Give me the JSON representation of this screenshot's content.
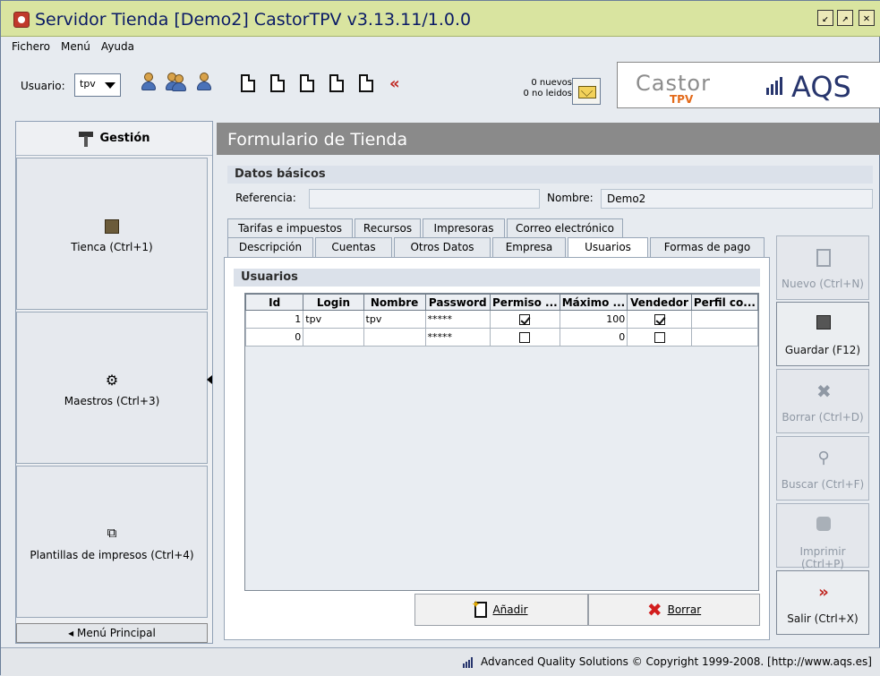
{
  "window": {
    "title": "Servidor Tienda  [Demo2] CastorTPV v3.13.11/1.0.0"
  },
  "menubar": [
    "Fichero",
    "Menú",
    "Ayuda"
  ],
  "toolbar": {
    "user_label": "Usuario:",
    "user_value": "tpv",
    "messages_new": "0 nuevos",
    "messages_unread": "0 no leidos",
    "logo_castor": "Castor",
    "logo_tpv": "TPV",
    "logo_aqs": "AQS"
  },
  "sidebar": {
    "header": "Gestión",
    "items": [
      {
        "label": "Tienca (Ctrl+1)",
        "icon": "store-icon"
      },
      {
        "label": "Maestros (Ctrl+3)",
        "icon": "gear-icon"
      },
      {
        "label": "Plantillas de impresos (Ctrl+4)",
        "icon": "copy-icon"
      }
    ],
    "footer": "Menú Principal"
  },
  "form": {
    "title": "Formulario de Tienda",
    "section_basic": "Datos básicos",
    "referencia_label": "Referencia:",
    "referencia_value": "",
    "nombre_label": "Nombre:",
    "nombre_value": "Demo2",
    "tabs_row1": [
      "Tarifas e impuestos",
      "Recursos",
      "Impresoras",
      "Correo electrónico"
    ],
    "tabs_row2": [
      "Descripción",
      "Cuentas",
      "Otros Datos",
      "Empresa",
      "Usuarios",
      "Formas de pago"
    ],
    "active_tab": "Usuarios",
    "section_users": "Usuarios",
    "grid": {
      "columns": [
        "Id",
        "Login",
        "Nombre",
        "Password",
        "Permiso ...",
        "Máximo ...",
        "Vendedor",
        "Perfil co..."
      ],
      "rows": [
        {
          "id": "1",
          "login": "tpv",
          "nombre": "tpv",
          "password": "*****",
          "permiso": true,
          "maximo": "100",
          "vendedor": true,
          "perfil": ""
        },
        {
          "id": "0",
          "login": "",
          "nombre": "",
          "password": "*****",
          "permiso": false,
          "maximo": "0",
          "vendedor": false,
          "perfil": ""
        }
      ]
    },
    "add_button": "Añadir",
    "delete_button": "Borrar"
  },
  "actions": [
    {
      "label": "Nuevo (Ctrl+N)",
      "enabled": false,
      "icon": "new-document-icon"
    },
    {
      "label": "Guardar (F12)",
      "enabled": true,
      "icon": "save-icon"
    },
    {
      "label": "Borrar (Ctrl+D)",
      "enabled": false,
      "icon": "delete-icon"
    },
    {
      "label": "Buscar (Ctrl+F)",
      "enabled": false,
      "icon": "search-icon"
    },
    {
      "label": "Imprimir (Ctrl+P)",
      "enabled": false,
      "icon": "print-icon"
    },
    {
      "label": "Salir (Ctrl+X)",
      "enabled": true,
      "icon": "exit-icon"
    }
  ],
  "status": {
    "text": "Advanced Quality Solutions © Copyright 1999-2008. [http://www.aqs.es]"
  },
  "colors": {
    "title_bar": "#d9e4a0",
    "title_text": "#0a1a66",
    "form_header": "#8a8a8a",
    "brand_aqs": "#27356d",
    "brand_tpv": "#e36a1a"
  }
}
